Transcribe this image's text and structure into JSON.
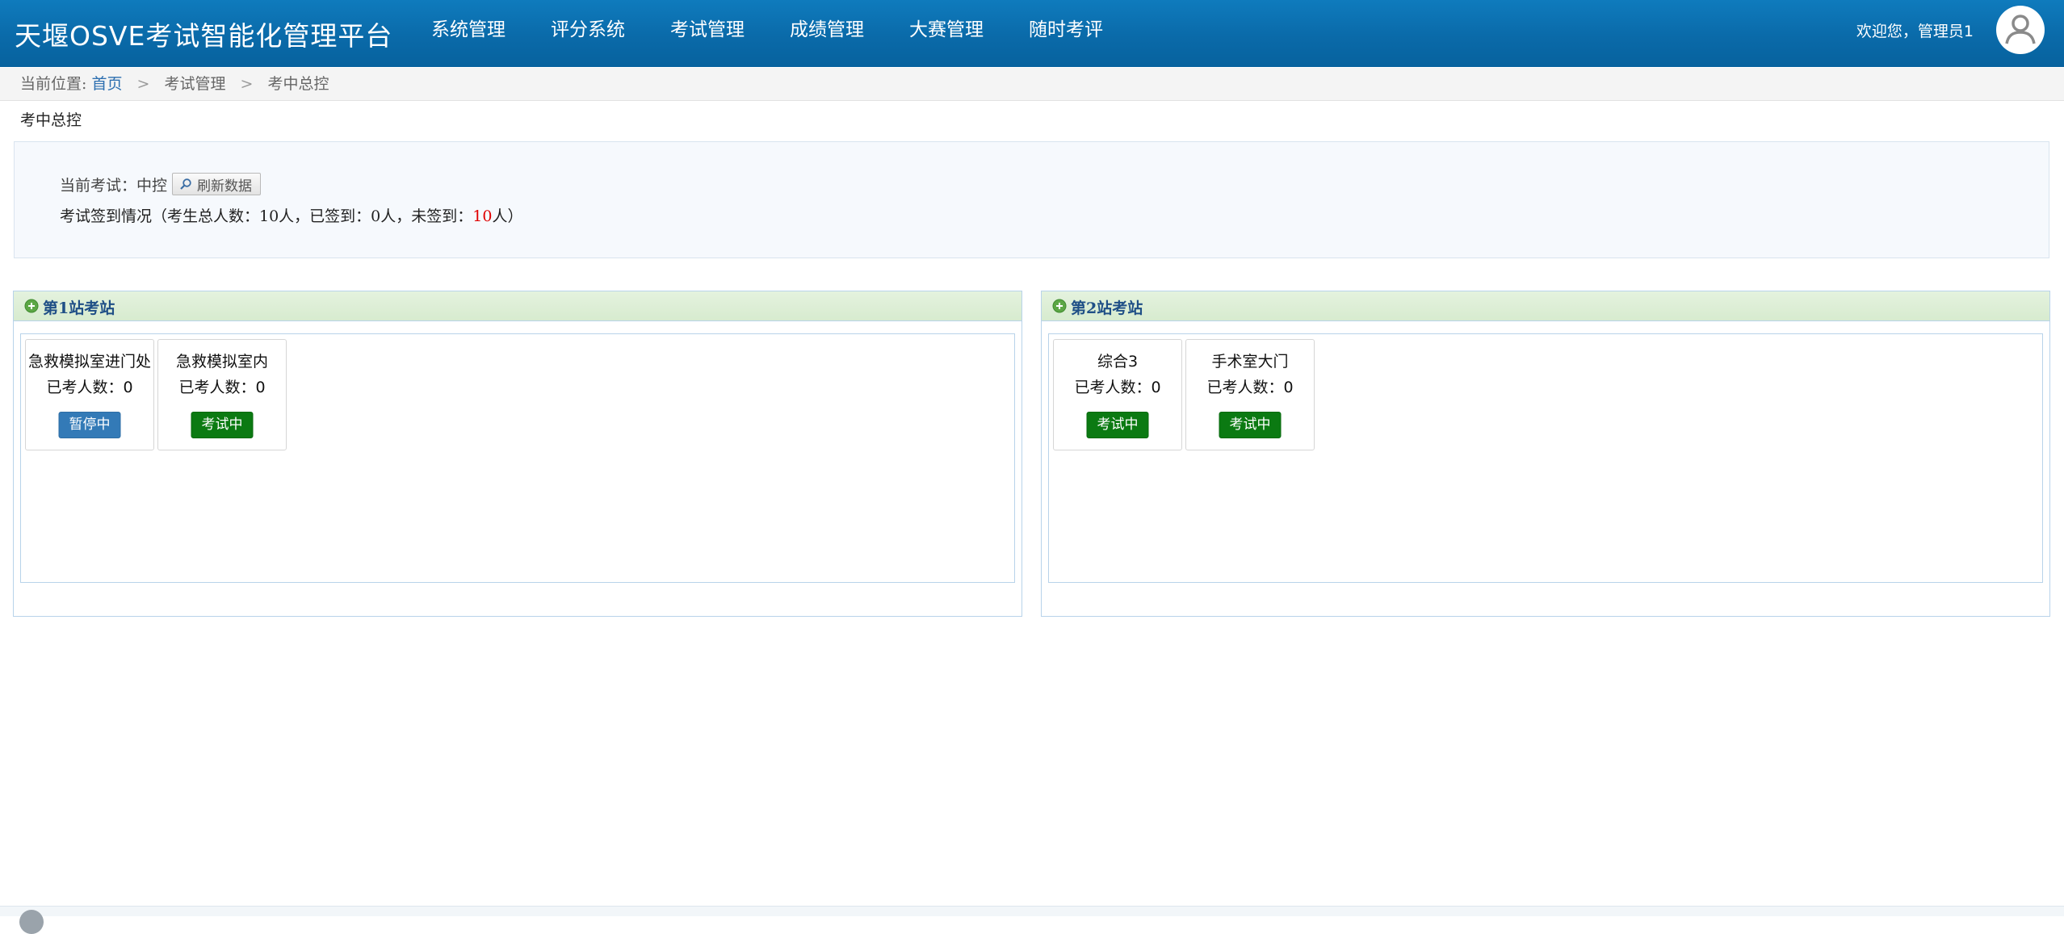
{
  "header": {
    "title": "天堰OSVE考试智能化管理平台",
    "nav": [
      "系统管理",
      "评分系统",
      "考试管理",
      "成绩管理",
      "大赛管理",
      "随时考评"
    ],
    "welcome": "欢迎您，管理员1"
  },
  "breadcrumb": {
    "prefix": "当前位置:",
    "home": "首页",
    "items": [
      "考试管理",
      "考中总控"
    ]
  },
  "page": {
    "title": "考中总控",
    "current_exam_label": "当前考试：中控",
    "refresh_label": "刷新数据",
    "signin_prefix": "考试签到情况（考生总人数：10人，已签到：0人，未签到：",
    "signin_unsigned": "10",
    "signin_suffix": "人）"
  },
  "stations": [
    {
      "title": "第1站考站",
      "rooms": [
        {
          "name": "急救模拟室进门处",
          "count": "已考人数：0",
          "status": "暂停中",
          "state": "paused"
        },
        {
          "name": "急救模拟室内",
          "count": "已考人数：0",
          "status": "考试中",
          "state": "active"
        }
      ]
    },
    {
      "title": "第2站考站",
      "rooms": [
        {
          "name": "综合3",
          "count": "已考人数：0",
          "status": "考试中",
          "state": "active"
        },
        {
          "name": "手术室大门",
          "count": "已考人数：0",
          "status": "考试中",
          "state": "active"
        }
      ]
    }
  ],
  "colors": {
    "header": "#0a6aa9",
    "paused": "#337ab7",
    "active": "#0b7a12",
    "station_head": "#d7ebcf",
    "unsigned": "#e00000"
  }
}
